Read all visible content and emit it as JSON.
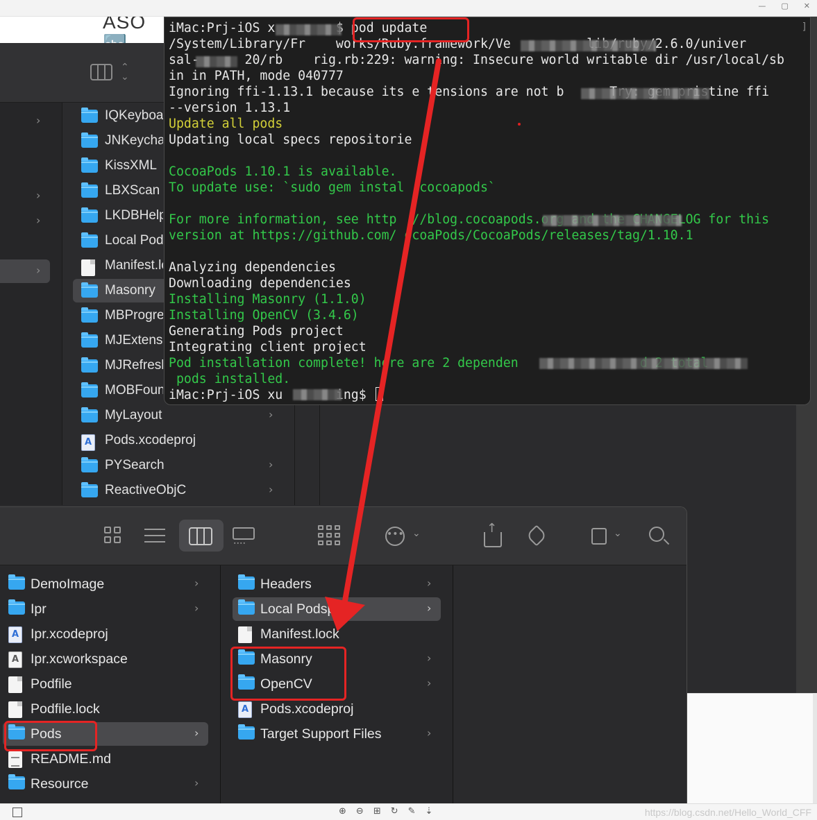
{
  "host": {
    "controls": [
      "—",
      "▢",
      "✕"
    ],
    "top_heading": "ASO 🔤",
    "watermark": "https://blog.csdn.net/Hello_World_CFF",
    "bottom_tools": [
      "⊕",
      "⊖",
      "⊞",
      "↻",
      "✎",
      "⇣"
    ]
  },
  "terminal": {
    "corner": "]",
    "lines": [
      {
        "color": "w",
        "text": "iMac:Prj-iOS x        $ pod update"
      },
      {
        "color": "w",
        "text": "/System/Library/Fr    works/Ruby.framework/Ve          lib/ruby/2.6.0/univer"
      },
      {
        "color": "w",
        "text": "sal-      20/rb    rig.rb:229: warning: Insecure world writable dir /usr/local/sb"
      },
      {
        "color": "w",
        "text": "in in PATH, mode 040777"
      },
      {
        "color": "w",
        "text": "Ignoring ffi-1.13.1 because its e tensions are not b      Try: gem pristine ffi"
      },
      {
        "color": "w",
        "text": "--version 1.13.1"
      },
      {
        "color": "y",
        "text": "Update all pods"
      },
      {
        "color": "w",
        "text": "Updating local specs repositorie"
      },
      {
        "color": "w",
        "text": ""
      },
      {
        "color": "g",
        "text": "CocoaPods 1.10.1 is available."
      },
      {
        "color": "g",
        "text": "To update use: `sudo gem instal  cocoapods`"
      },
      {
        "color": "g",
        "text": ""
      },
      {
        "color": "g",
        "text": "For more information, see http  //blog.cocoapods.org and the CHANGELOG for this"
      },
      {
        "color": "g",
        "text": "version at https://github.com/ ocoaPods/CocoaPods/releases/tag/1.10.1"
      },
      {
        "color": "w",
        "text": ""
      },
      {
        "color": "w",
        "text": "Analyzing dependencies"
      },
      {
        "color": "w",
        "text": "Downloading dependencies"
      },
      {
        "color": "g",
        "text": "Installing Masonry (1.1.0)"
      },
      {
        "color": "g",
        "text": "Installing OpenCV (3.4.6)"
      },
      {
        "color": "w",
        "text": "Generating Pods project"
      },
      {
        "color": "w",
        "text": "Integrating client project"
      },
      {
        "color": "g",
        "text": "Pod installation complete! here are 2 dependen                d 2 total"
      },
      {
        "color": "g",
        "text": " pods installed."
      },
      {
        "color": "w",
        "text": "iMac:Prj-iOS xu       ing$ "
      }
    ]
  },
  "back_finder": {
    "items": [
      {
        "label": "IQKeyboardManager",
        "icon": "folder",
        "chev": false
      },
      {
        "label": "JNKeychain",
        "icon": "folder",
        "chev": false
      },
      {
        "label": "KissXML",
        "icon": "folder",
        "chev": false
      },
      {
        "label": "LBXScan",
        "icon": "folder",
        "chev": false
      },
      {
        "label": "LKDBHelper",
        "icon": "folder",
        "chev": false
      },
      {
        "label": "Local Podspecs",
        "icon": "folder",
        "chev": false
      },
      {
        "label": "Manifest.lock",
        "icon": "doc",
        "chev": false
      },
      {
        "label": "Masonry",
        "icon": "folder",
        "chev": false,
        "selected": true
      },
      {
        "label": "MBProgressHUD",
        "icon": "folder",
        "chev": false
      },
      {
        "label": "MJExtension",
        "icon": "folder",
        "chev": false
      },
      {
        "label": "MJRefresh",
        "icon": "folder",
        "chev": false
      },
      {
        "label": "MOBFoundation",
        "icon": "folder",
        "chev": false
      },
      {
        "label": "MyLayout",
        "icon": "folder",
        "chev": true
      },
      {
        "label": "Pods.xcodeproj",
        "icon": "xcodeproj",
        "chev": false
      },
      {
        "label": "PYSearch",
        "icon": "folder",
        "chev": true
      },
      {
        "label": "ReactiveObjC",
        "icon": "folder",
        "chev": true
      }
    ]
  },
  "front_finder": {
    "col1": [
      {
        "label": "DemoImage",
        "icon": "folder",
        "chev": true
      },
      {
        "label": "Ipr",
        "icon": "folder",
        "chev": true
      },
      {
        "label": "Ipr.xcodeproj",
        "icon": "xcodeproj",
        "chev": false
      },
      {
        "label": "Ipr.xcworkspace",
        "icon": "xcodews",
        "chev": false
      },
      {
        "label": "Podfile",
        "icon": "doc",
        "chev": false
      },
      {
        "label": "Podfile.lock",
        "icon": "doc",
        "chev": false
      },
      {
        "label": "Pods",
        "icon": "folder",
        "chev": true,
        "selected": true
      },
      {
        "label": "README.md",
        "icon": "readme",
        "chev": false
      },
      {
        "label": "Resource",
        "icon": "folder",
        "chev": true
      }
    ],
    "col2": [
      {
        "label": "Headers",
        "icon": "folder",
        "chev": true
      },
      {
        "label": "Local Podspecs",
        "icon": "folder",
        "chev": true,
        "selected": true
      },
      {
        "label": "Manifest.lock",
        "icon": "doc",
        "chev": false
      },
      {
        "label": "Masonry",
        "icon": "folder",
        "chev": true
      },
      {
        "label": "OpenCV",
        "icon": "folder",
        "chev": true
      },
      {
        "label": "Pods.xcodeproj",
        "icon": "xcodeproj",
        "chev": false
      },
      {
        "label": "Target Support Files",
        "icon": "folder",
        "chev": true
      }
    ],
    "toolbar": {
      "more_glyph": "•••",
      "chevron": "⌄"
    }
  },
  "colors": {
    "annotation_red": "#e52424",
    "terminal_green": "#33c94a",
    "terminal_yellow": "#d3d038",
    "folder_blue": "#36a7f0"
  }
}
